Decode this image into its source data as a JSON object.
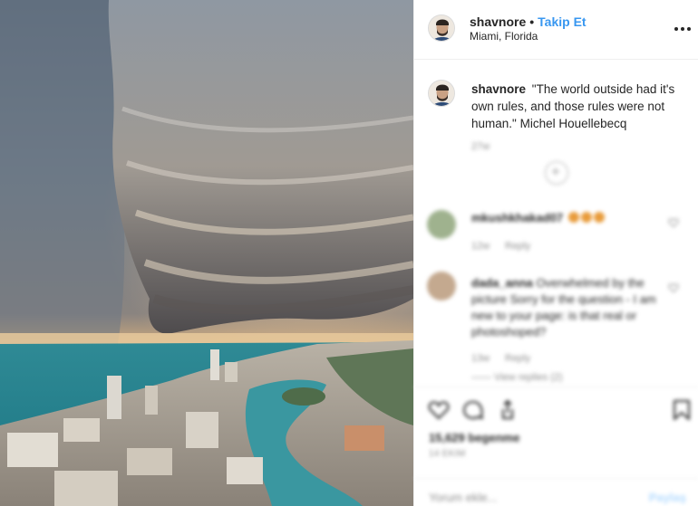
{
  "post": {
    "username": "shavnore",
    "separator": "•",
    "follow_label": "Takip Et",
    "location": "Miami, Florida",
    "more_icon": "more-horizontal-icon"
  },
  "caption": {
    "username": "shavnore",
    "text": "\"The world outside had it's own rules, and those rules were not human.\" Michel Houellebecq",
    "age": "27w"
  },
  "load_more_icon": "plus-circle-icon",
  "comments": [
    {
      "username": "mkushkhakad07",
      "age": "12w",
      "reply_label": "Reply",
      "heart_icon": "heart-small-icon"
    },
    {
      "username": "dada_anna",
      "text": "Overwhelmed by the picture Sorry for the question - I am new to your page: is that real or photoshoped?",
      "age": "13w",
      "reply_label": "Reply",
      "replies_label": "View replies (2)",
      "heart_icon": "heart-small-icon"
    }
  ],
  "actions": {
    "like_icon": "heart-icon",
    "comment_icon": "comment-icon",
    "share_icon": "share-icon",
    "save_icon": "bookmark-icon",
    "likes_text": "15,629 begenme",
    "date_text": "14 EKIM"
  },
  "comment_input": {
    "placeholder": "Yorum ekle...",
    "post_label": "Paylaş"
  },
  "colors": {
    "link_blue": "#3897f0",
    "text_dark": "#262626",
    "text_muted": "#8e8e8e",
    "border": "#efefef"
  }
}
